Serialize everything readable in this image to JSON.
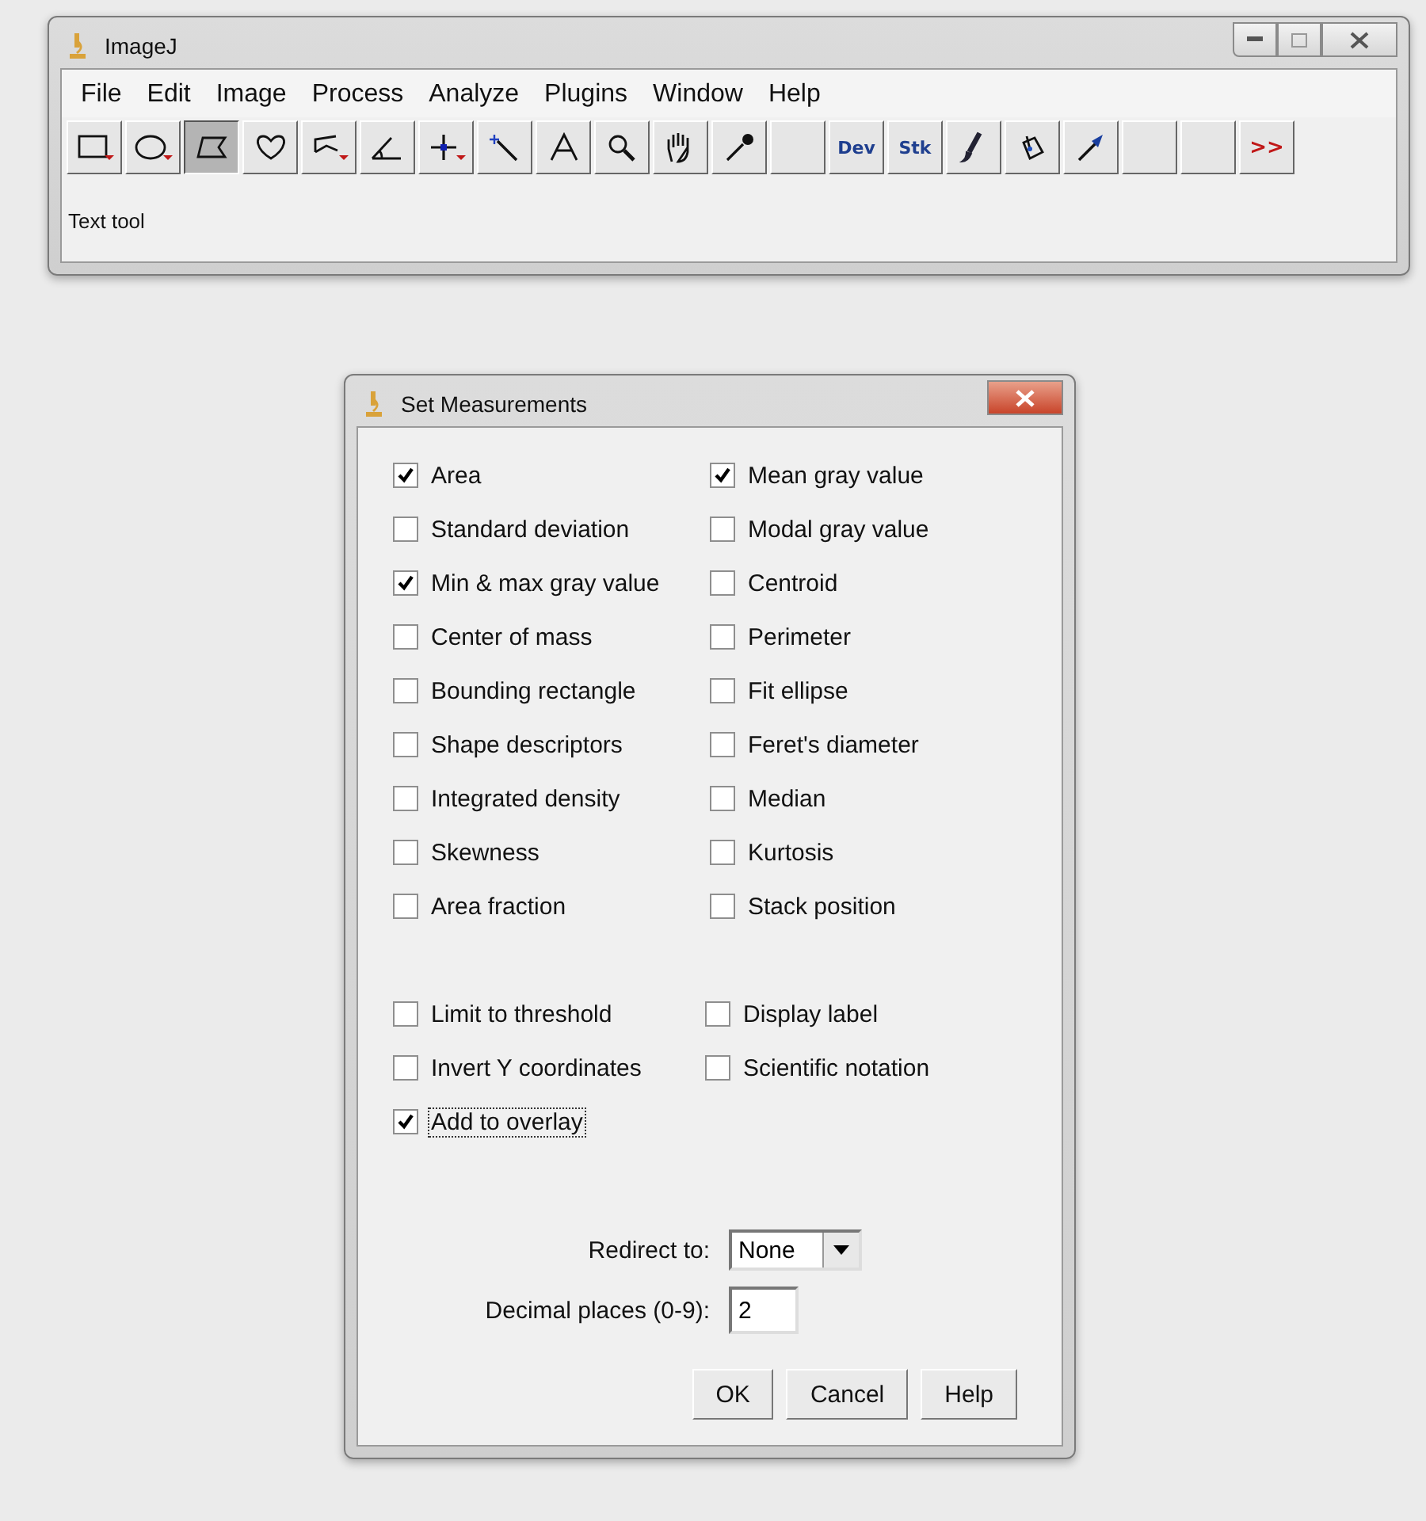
{
  "main_window": {
    "title": "ImageJ",
    "menu": [
      "File",
      "Edit",
      "Image",
      "Process",
      "Analyze",
      "Plugins",
      "Window",
      "Help"
    ],
    "tools": [
      {
        "kind": "rectangle",
        "selected": false
      },
      {
        "kind": "oval",
        "selected": false
      },
      {
        "kind": "polygon",
        "selected": true
      },
      {
        "kind": "freehand",
        "selected": false
      },
      {
        "kind": "polyline",
        "selected": false
      },
      {
        "kind": "angle",
        "selected": false
      },
      {
        "kind": "point",
        "selected": false
      },
      {
        "kind": "wand",
        "selected": false
      },
      {
        "kind": "text",
        "selected": false
      },
      {
        "kind": "magnifier",
        "selected": false
      },
      {
        "kind": "hand",
        "selected": false
      },
      {
        "kind": "dropper",
        "selected": false
      },
      {
        "kind": "empty",
        "selected": false
      },
      {
        "kind": "label",
        "label": "Dev",
        "selected": false
      },
      {
        "kind": "label",
        "label": "Stk",
        "selected": false
      },
      {
        "kind": "brush",
        "selected": false
      },
      {
        "kind": "fill",
        "selected": false
      },
      {
        "kind": "arrow",
        "selected": false
      },
      {
        "kind": "empty",
        "selected": false
      },
      {
        "kind": "empty",
        "selected": false
      },
      {
        "kind": "more",
        "label": ">>",
        "selected": false
      }
    ],
    "status": "Text tool"
  },
  "dialog": {
    "title": "Set Measurements",
    "measurements": [
      {
        "label": "Area",
        "checked": true
      },
      {
        "label": "Mean gray value",
        "checked": true
      },
      {
        "label": "Standard deviation",
        "checked": false
      },
      {
        "label": "Modal gray value",
        "checked": false
      },
      {
        "label": "Min & max gray value",
        "checked": true
      },
      {
        "label": "Centroid",
        "checked": false
      },
      {
        "label": "Center of mass",
        "checked": false
      },
      {
        "label": "Perimeter",
        "checked": false
      },
      {
        "label": "Bounding rectangle",
        "checked": false
      },
      {
        "label": "Fit ellipse",
        "checked": false
      },
      {
        "label": "Shape descriptors",
        "checked": false
      },
      {
        "label": "Feret's diameter",
        "checked": false
      },
      {
        "label": "Integrated density",
        "checked": false
      },
      {
        "label": "Median",
        "checked": false
      },
      {
        "label": "Skewness",
        "checked": false
      },
      {
        "label": "Kurtosis",
        "checked": false
      },
      {
        "label": "Area fraction",
        "checked": false
      },
      {
        "label": "Stack position",
        "checked": false
      }
    ],
    "options": [
      {
        "label": "Limit to threshold",
        "checked": false,
        "focused": false
      },
      {
        "label": "Display label",
        "checked": false,
        "focused": false
      },
      {
        "label": "Invert Y coordinates",
        "checked": false,
        "focused": false
      },
      {
        "label": "Scientific notation",
        "checked": false,
        "focused": false
      },
      {
        "label": "Add to overlay",
        "checked": true,
        "focused": true
      }
    ],
    "redirect": {
      "label": "Redirect to:",
      "value": "None"
    },
    "decimal": {
      "label": "Decimal places (0-9):",
      "value": "2"
    },
    "buttons": [
      "OK",
      "Cancel",
      "Help"
    ]
  }
}
